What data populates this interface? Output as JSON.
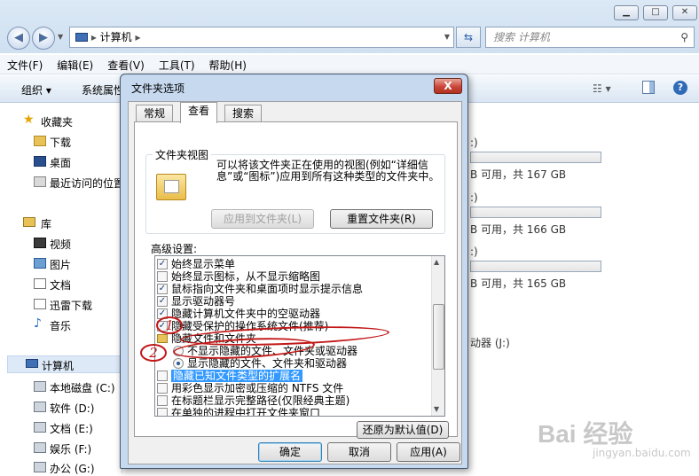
{
  "explorer": {
    "address_path": "计算机",
    "search_placeholder": "搜索 计算机",
    "menu": [
      "文件(F)",
      "编辑(E)",
      "查看(V)",
      "工具(T)",
      "帮助(H)"
    ],
    "toolbar": {
      "organize": "组织",
      "system_props": "系统属性"
    },
    "sidebar": {
      "favorites_header": "收藏夹",
      "favorites": [
        "下载",
        "桌面",
        "最近访问的位置"
      ],
      "library_header": "库",
      "libraries": [
        "视频",
        "图片",
        "文档",
        "迅雷下载",
        "音乐"
      ],
      "computer_header": "计算机",
      "drives": [
        "本地磁盘 (C:)",
        "软件 (D:)",
        "文档 (E:)",
        "娱乐 (F:)",
        "办公 (G:)"
      ]
    },
    "drive_panel": [
      {
        "label": ":)",
        "free": "B 可用，共 167 GB",
        "fill": 0.0
      },
      {
        "label": ":)",
        "free": "B 可用，共 166 GB",
        "fill": 0.0
      },
      {
        "label": ":)",
        "free": "B 可用，共 165 GB",
        "fill": 0.0
      }
    ],
    "removable_drive": "动器 (J:)"
  },
  "dialog": {
    "title": "文件夹选项",
    "close_label": "X",
    "tabs": [
      "常规",
      "查看",
      "搜索"
    ],
    "active_tab": 1,
    "folder_views": {
      "legend": "文件夹视图",
      "description": "可以将该文件夹正在使用的视图(例如“详细信息”或“图标”)应用到所有这种类型的文件夹中。",
      "apply_button": "应用到文件夹(L)",
      "reset_button": "重置文件夹(R)"
    },
    "advanced_label": "高级设置:",
    "settings": [
      {
        "type": "check",
        "checked": true,
        "label": "始终显示菜单"
      },
      {
        "type": "check",
        "checked": false,
        "label": "始终显示图标，从不显示缩略图"
      },
      {
        "type": "check",
        "checked": true,
        "label": "鼠标指向文件夹和桌面项时显示提示信息"
      },
      {
        "type": "check",
        "checked": true,
        "label": "显示驱动器号"
      },
      {
        "type": "check",
        "checked": true,
        "label": "隐藏计算机文件夹中的空驱动器"
      },
      {
        "type": "check",
        "checked": true,
        "label": "隐藏受保护的操作系统文件(推荐)"
      },
      {
        "type": "folder",
        "label": "隐藏文件和文件夹"
      },
      {
        "type": "radio",
        "checked": false,
        "label": "不显示隐藏的文件、文件夹或驱动器"
      },
      {
        "type": "radio",
        "checked": true,
        "label": "显示隐藏的文件、文件夹和驱动器"
      },
      {
        "type": "check",
        "checked": false,
        "label": "隐藏已知文件类型的扩展名",
        "selected": true
      },
      {
        "type": "check",
        "checked": false,
        "label": "用彩色显示加密或压缩的 NTFS 文件"
      },
      {
        "type": "check",
        "checked": false,
        "label": "在标题栏显示完整路径(仅限经典主题)"
      },
      {
        "type": "check",
        "checked": false,
        "label": "在单独的进程中打开文件夹窗口"
      }
    ],
    "restore_defaults": "还原为默认值(D)",
    "ok": "确定",
    "cancel": "取消",
    "apply": "应用(A)"
  },
  "annotations": {
    "one": "1",
    "two": "2"
  },
  "watermark": {
    "brand": "Bai 经验",
    "url": "jingyan.baidu.com"
  },
  "colors": {
    "selection": "#3399ff",
    "annotation": "#c21818"
  }
}
